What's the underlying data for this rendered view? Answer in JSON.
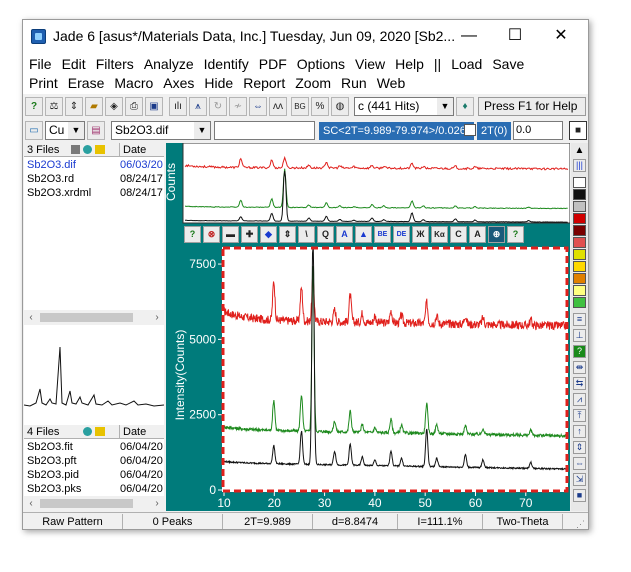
{
  "window": {
    "title": "Jade 6 [asus*/Materials Data, Inc.] Tuesday, Jun 09, 2020 [Sb2...",
    "controls": [
      "—",
      "☐",
      "✕"
    ]
  },
  "menu": {
    "row1": [
      "File",
      "Edit",
      "Filters",
      "Analyze",
      "Identify",
      "PDF",
      "Options",
      "View",
      "Help",
      "||",
      "Load",
      "Save"
    ],
    "row2": [
      "Print",
      "Erase",
      "Macro",
      "Axes",
      "Hide",
      "Report",
      "Zoom",
      "Run",
      "Web"
    ]
  },
  "toolbar1": {
    "hits_combo": "c (441 Hits)",
    "help_label": "Press F1 for Help"
  },
  "toolbar2": {
    "element_combo": "Cu",
    "file_combo": "Sb2O3.dif",
    "sc_text": "SC<2T=9.989-79.974>/0.026",
    "twotheta_label": "2T(0)",
    "offset_value": "0.0"
  },
  "top_files": {
    "header_name": "3 Files",
    "header_date": "Date",
    "rows": [
      {
        "name": "Sb2O3.dif",
        "date": "06/03/20",
        "highlight": true
      },
      {
        "name": "Sb2O3.rd",
        "date": "08/24/17",
        "highlight": false
      },
      {
        "name": "Sb2O3.xrdml",
        "date": "08/24/17",
        "highlight": false
      }
    ]
  },
  "bottom_files": {
    "header_name": "4 Files",
    "header_date": "Date",
    "rows": [
      {
        "name": "Sb2O3.fit",
        "date": "06/04/20"
      },
      {
        "name": "Sb2O3.pft",
        "date": "06/04/20"
      },
      {
        "name": "Sb2O3.pid",
        "date": "06/04/20"
      },
      {
        "name": "Sb2O3.pks",
        "date": "06/04/20"
      }
    ]
  },
  "overview": {
    "ylabel": "Counts"
  },
  "plot_toolbar": {
    "buttons": [
      "?",
      "⊗",
      "▬",
      "✚",
      "◆",
      "⇕",
      "\\",
      "Q",
      "A",
      "▲",
      "BE",
      "DE",
      "Ж",
      "Kα",
      "C",
      "A",
      "⊕",
      "?"
    ]
  },
  "statusbar": {
    "mode": "Raw Pattern",
    "peaks": "0 Peaks",
    "twotheta": "2T=9.989",
    "dspacing": "d=8.8474",
    "intensity": "I=111.1%",
    "axis": "Two-Theta"
  },
  "colors": {
    "teal_background": "#007b7b",
    "red_series": "#e0201c",
    "green_series": "#1e8a1e",
    "black_series": "#111111",
    "selection_border": "#e0201c",
    "sc_bar": "#2a6db3"
  },
  "chart_data": {
    "type": "line",
    "ylabel": "Intensity(Counts)",
    "xlim": [
      10,
      78
    ],
    "ylim": [
      0,
      8000
    ],
    "x_ticks": [
      10,
      20,
      30,
      40,
      50,
      60,
      70
    ],
    "y_ticks": [
      0,
      2500,
      5000,
      7500
    ],
    "series": [
      {
        "color": "red",
        "base": 5650,
        "peaks": [
          [
            19.9,
            1300
          ],
          [
            25.4,
            1100
          ],
          [
            27.7,
            1500
          ],
          [
            32.0,
            400
          ],
          [
            35.1,
            900
          ],
          [
            37.5,
            300
          ],
          [
            40.0,
            220
          ],
          [
            43.2,
            400
          ],
          [
            45.3,
            260
          ],
          [
            50.3,
            700
          ],
          [
            52.3,
            260
          ],
          [
            58.0,
            300
          ],
          [
            61.5,
            220
          ],
          [
            71.0,
            180
          ]
        ]
      },
      {
        "color": "green",
        "base": 2000,
        "peaks": [
          [
            19.9,
            1000
          ],
          [
            25.4,
            1200
          ],
          [
            27.7,
            5500
          ],
          [
            32.0,
            350
          ],
          [
            35.1,
            700
          ],
          [
            37.5,
            260
          ],
          [
            40.0,
            160
          ],
          [
            43.2,
            450
          ],
          [
            45.3,
            260
          ],
          [
            50.3,
            1000
          ],
          [
            52.3,
            300
          ],
          [
            58.0,
            280
          ],
          [
            61.5,
            200
          ],
          [
            71.0,
            160
          ]
        ]
      },
      {
        "color": "black",
        "base": 900,
        "peaks": [
          [
            19.9,
            600
          ],
          [
            25.4,
            1100
          ],
          [
            27.7,
            7800
          ],
          [
            32.0,
            450
          ],
          [
            35.1,
            700
          ],
          [
            37.5,
            280
          ],
          [
            40.0,
            180
          ],
          [
            43.2,
            500
          ],
          [
            45.3,
            260
          ],
          [
            50.3,
            1250
          ],
          [
            52.3,
            280
          ],
          [
            58.0,
            420
          ],
          [
            61.5,
            260
          ],
          [
            71.0,
            200
          ]
        ]
      }
    ]
  }
}
